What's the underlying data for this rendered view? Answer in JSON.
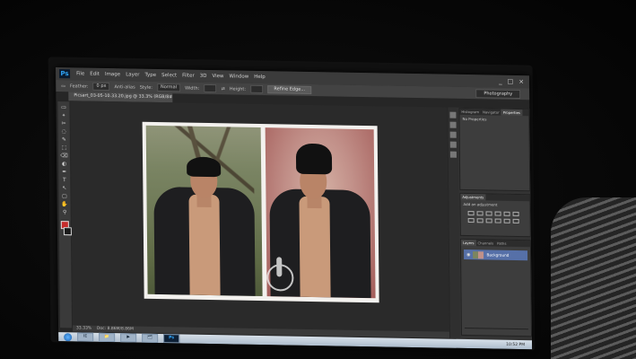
{
  "app": {
    "logo_text": "Ps",
    "menus": [
      "File",
      "Edit",
      "Image",
      "Layer",
      "Type",
      "Select",
      "Filter",
      "3D",
      "View",
      "Window",
      "Help"
    ],
    "window_controls": [
      "_",
      "□",
      "×"
    ]
  },
  "options_bar": {
    "feather_label": "Feather:",
    "feather_value": "0 px",
    "antialias_label": "Anti-alias",
    "style_label": "Style:",
    "style_value": "Normal",
    "width_label": "Width:",
    "height_label": "Height:",
    "refine_button": "Refine Edge...",
    "workspace": "Photography"
  },
  "document": {
    "tab_title": "Picsart_03-05-10.33.20.jpg @ 33.3% (RGB/8#)",
    "status_zoom": "33.33%",
    "status_doc": "Doc: 8.86M/8.86M"
  },
  "tools": [
    "▭",
    "⌖",
    "✂",
    "◌",
    "✎",
    "⬚",
    "⌫",
    "◐",
    "✒",
    "T",
    "↖",
    "▢",
    "✋",
    "⚲"
  ],
  "panels": {
    "top_tabs": [
      "Histogram",
      "Navigator",
      "Properties"
    ],
    "properties_title": "No Properties",
    "adjustments_tab": "Adjustments",
    "adjustments_title": "Add an adjustment",
    "layers_tabs": [
      "Layers",
      "Channels",
      "Paths"
    ],
    "layer_name": "Background"
  },
  "taskbar": {
    "apps": [
      "IE",
      "📁",
      "▶",
      "🗂",
      "Ps"
    ],
    "clock": "10:52 PM"
  }
}
